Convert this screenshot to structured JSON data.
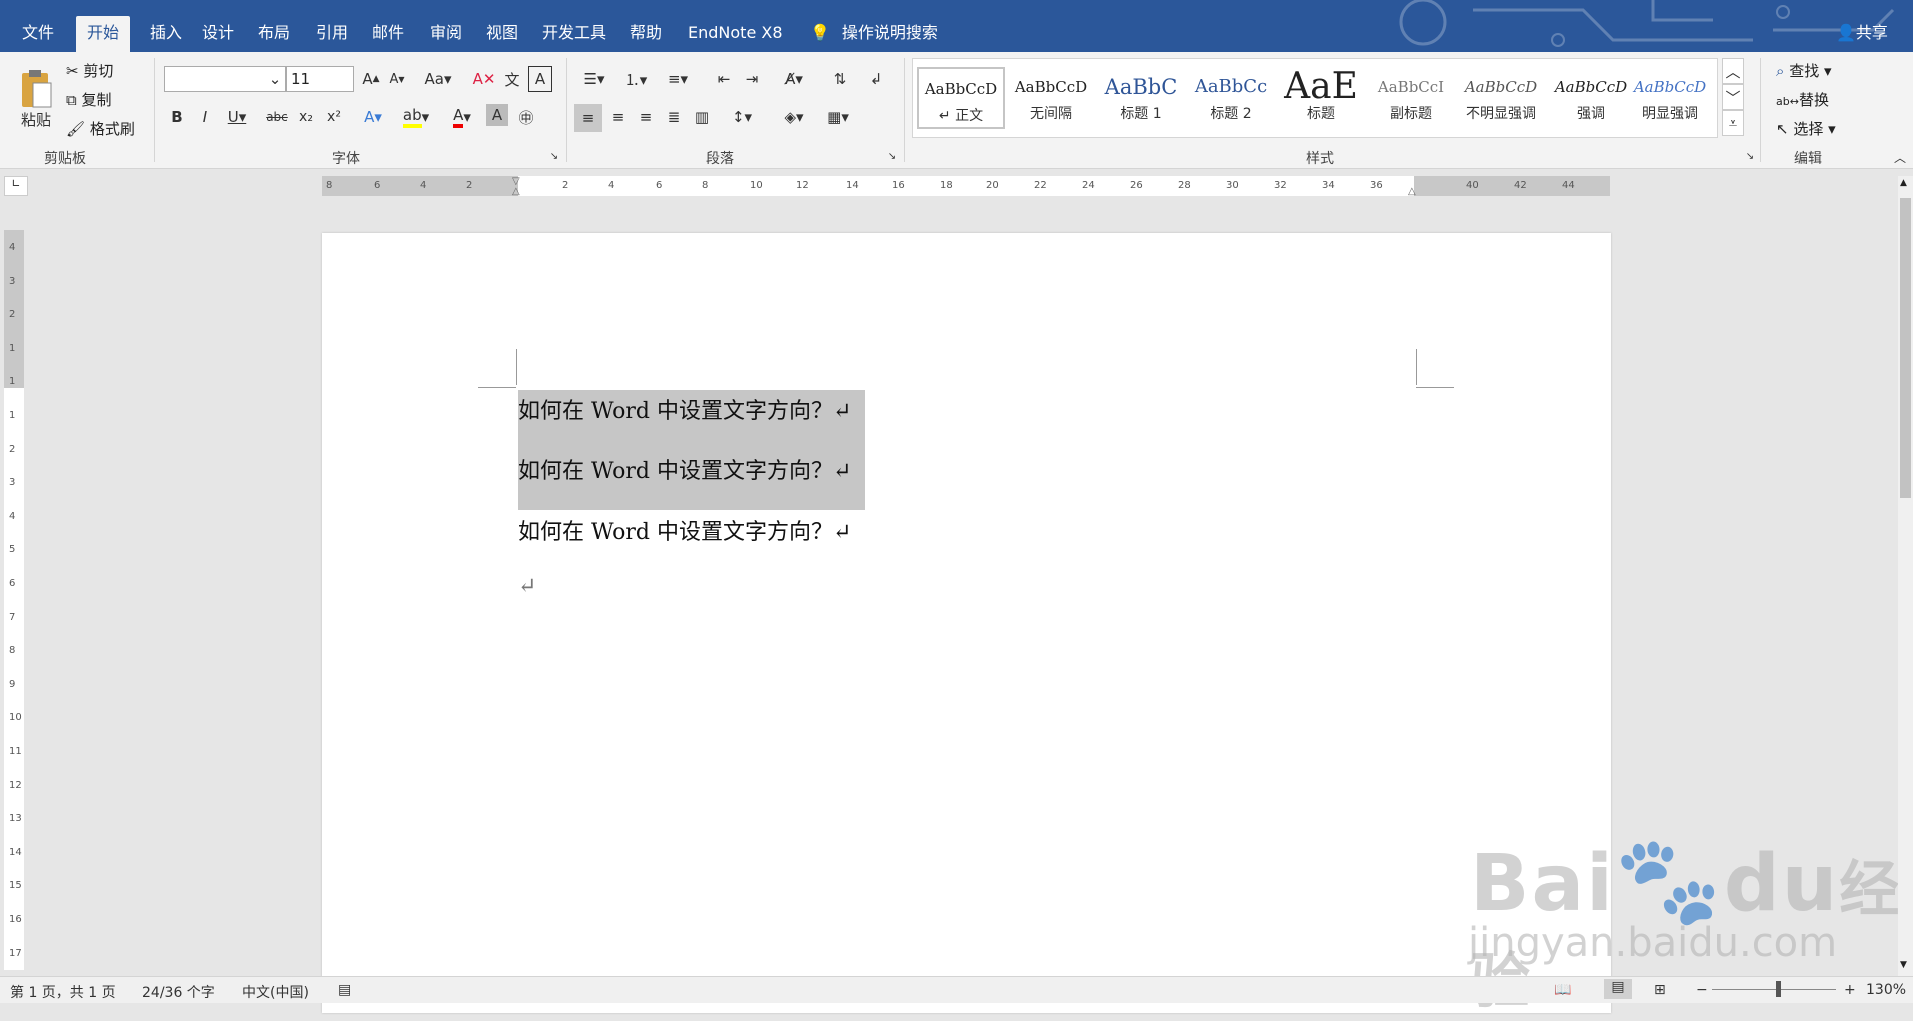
{
  "tabs": [
    "文件",
    "开始",
    "插入",
    "设计",
    "布局",
    "引用",
    "邮件",
    "审阅",
    "视图",
    "开发工具",
    "帮助",
    "EndNote X8"
  ],
  "tell_me": "操作说明搜索",
  "share": "共享",
  "clipboard": {
    "paste": "粘贴",
    "cut": "剪切",
    "copy": "复制",
    "format_painter": "格式刷",
    "label": "剪贴板"
  },
  "font": {
    "name": "",
    "size": "11",
    "change_case": "Aa",
    "label": "字体"
  },
  "paragraph": {
    "label": "段落"
  },
  "styles": {
    "label": "样式",
    "items": [
      {
        "sample": "AaBbCcD",
        "name": "↵ 正文"
      },
      {
        "sample": "AaBbCcD",
        "name": "无间隔"
      },
      {
        "sample": "AaBbC",
        "name": "标题 1"
      },
      {
        "sample": "AaBbCc",
        "name": "标题 2"
      },
      {
        "sample": "AaE",
        "name": "标题"
      },
      {
        "sample": "AaBbCcI",
        "name": "副标题"
      },
      {
        "sample": "AaBbCcD",
        "name": "不明显强调"
      },
      {
        "sample": "AaBbCcD",
        "name": "强调"
      },
      {
        "sample": "AaBbCcD",
        "name": "明显强调"
      }
    ]
  },
  "editing": {
    "find": "查找",
    "replace": "替换",
    "select": "选择",
    "label": "编辑"
  },
  "ruler_ticks": [
    "8",
    "6",
    "4",
    "2",
    "2",
    "4",
    "6",
    "8",
    "10",
    "12",
    "14",
    "16",
    "18",
    "20",
    "22",
    "24",
    "26",
    "28",
    "30",
    "32",
    "34",
    "36",
    "40",
    "42",
    "44"
  ],
  "vruler_ticks": [
    "4",
    "3",
    "2",
    "1",
    "1",
    "1",
    "2",
    "3",
    "4",
    "5",
    "6",
    "7",
    "8",
    "9",
    "10",
    "11",
    "12",
    "13",
    "14",
    "15",
    "16",
    "17"
  ],
  "document": {
    "lines": [
      "如何在 Word 中设置文字方向？↵",
      "如何在 Word 中设置文字方向？↵",
      "如何在 Word 中设置文字方向？↵",
      "↵"
    ]
  },
  "status": {
    "page": "第 1 页，共 1 页",
    "words": "24/36 个字",
    "lang": "中文(中国)",
    "zoom": "130%"
  },
  "watermark": {
    "brand": "Bai",
    "brand2": "du",
    "cn": "经验",
    "url": "jingyan.baidu.com"
  }
}
